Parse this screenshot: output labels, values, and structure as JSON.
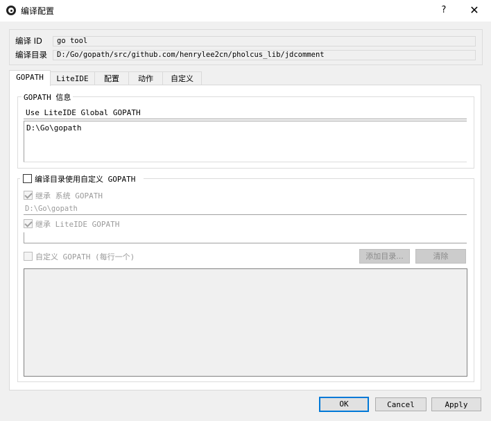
{
  "window": {
    "title": "编译配置",
    "help_label": "?",
    "close_label": "✕"
  },
  "header": {
    "build_id_label": "编译 ID",
    "build_id_value": "go tool",
    "build_dir_label": "编译目录",
    "build_dir_value": "D:/Go/gopath/src/github.com/henrylee2cn/pholcus_lib/jdcomment"
  },
  "tabs": [
    {
      "label": "GOPATH",
      "active": true
    },
    {
      "label": "LiteIDE",
      "active": false
    },
    {
      "label": "配置",
      "active": false
    },
    {
      "label": "动作",
      "active": false
    },
    {
      "label": "自定义",
      "active": false
    }
  ],
  "gopath_info": {
    "group_title": "GOPATH 信息",
    "mode_text": "Use LiteIDE Global GOPATH",
    "paths_text": "D:\\Go\\gopath"
  },
  "custom": {
    "use_custom_label": "编译目录使用自定义 GOPATH",
    "inherit_system_label": "继承 系统 GOPATH",
    "system_path_value": "D:\\Go\\gopath",
    "inherit_liteide_label": "继承 LiteIDE GOPATH",
    "liteide_path_value": "",
    "custom_gopath_label": "自定义 GOPATH (每行一个)",
    "add_dir_label": "添加目录...",
    "clear_label": "清除"
  },
  "footer": {
    "ok_label": "OK",
    "cancel_label": "Cancel",
    "apply_label": "Apply"
  }
}
